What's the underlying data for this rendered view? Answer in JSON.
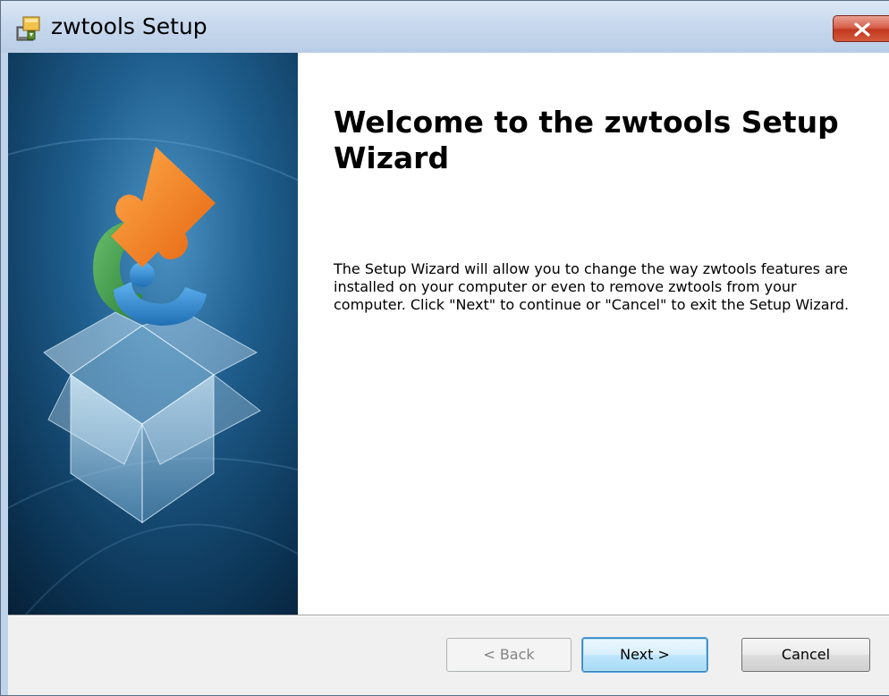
{
  "window": {
    "title": "zwtools Setup",
    "icon": "installer-package-icon",
    "close_icon": "close-icon"
  },
  "banner": {
    "image": "puzzle-box-graphic",
    "colors": {
      "background_dark": "#0b2a45",
      "background_light": "#2a6fa0",
      "puzzle_orange": "#f07a1c",
      "puzzle_green": "#3f9a4a",
      "puzzle_blue": "#2f86cc"
    }
  },
  "welcome": {
    "title": "Welcome to the zwtools Setup Wizard",
    "body": "The Setup Wizard will allow you to change the way zwtools features are installed on your computer or even to remove zwtools from your computer.  Click \"Next\" to continue or \"Cancel\" to exit the Setup Wizard."
  },
  "buttons": {
    "back": "< Back",
    "next": "Next >",
    "cancel": "Cancel"
  }
}
